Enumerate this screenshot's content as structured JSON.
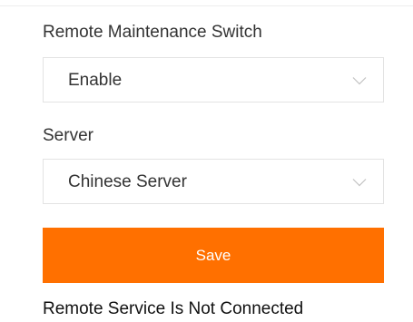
{
  "remote_maintenance": {
    "label": "Remote Maintenance Switch",
    "selected_value": "Enable"
  },
  "server": {
    "label": "Server",
    "selected_value": "Chinese Server"
  },
  "actions": {
    "save_label": "Save"
  },
  "status": {
    "text": "Remote Service Is Not Connected"
  },
  "icons": {
    "dropdown": "chevron-down-icon"
  },
  "colors": {
    "accent": "#ff7000",
    "text": "#333333",
    "border": "#e3e3e3"
  }
}
